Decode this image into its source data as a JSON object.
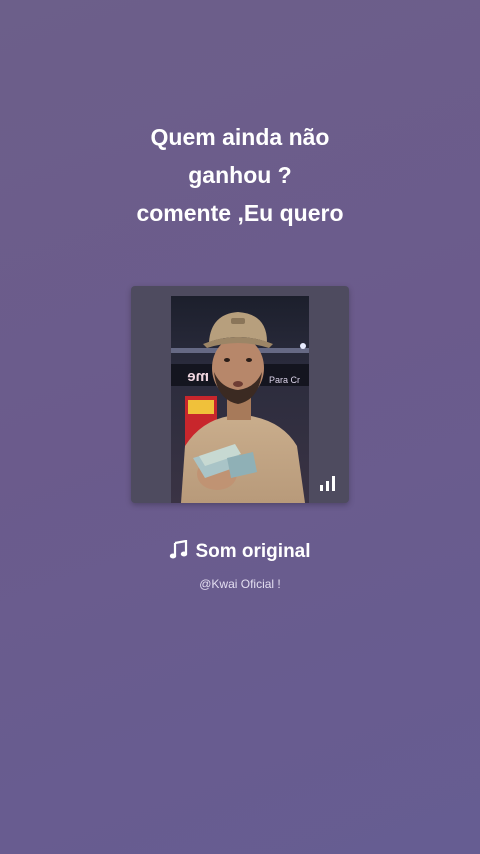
{
  "caption": {
    "lines": [
      "Quem ainda não",
      "ganhou ?",
      "comente ,Eu quero"
    ]
  },
  "video_thumbnail": {
    "description": "Thumbnail of a video: a young man with a beige cap and beige sweater holding banknotes, restaurant signage behind him",
    "signage_text": "Para Cr",
    "play_indicator_icon": "bars-icon"
  },
  "sound": {
    "icon": "music-note-icon",
    "title": "Som original",
    "author": "@Kwai Oficial !"
  },
  "colors": {
    "background_top": "#6c5f8a",
    "background_bottom": "#665d92",
    "card_background": "#4e4b5f",
    "text": "#ffffff"
  }
}
